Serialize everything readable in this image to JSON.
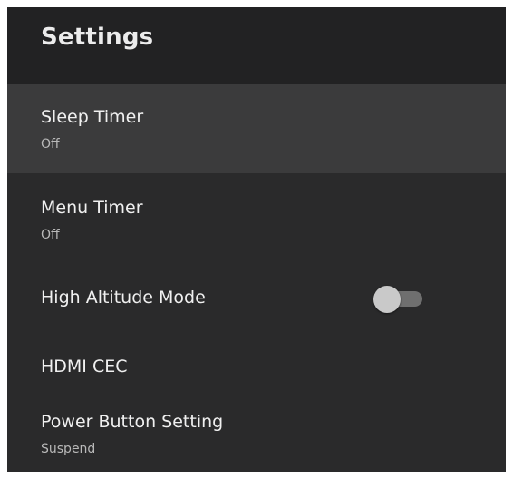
{
  "header": {
    "title": "Settings"
  },
  "items": [
    {
      "label": "Sleep Timer",
      "value": "Off",
      "focused": true
    },
    {
      "label": "Menu Timer",
      "value": "Off"
    },
    {
      "label": "High Altitude Mode",
      "toggle": false
    },
    {
      "label": "HDMI CEC"
    },
    {
      "label": "Power Button Setting",
      "value": "Suspend"
    }
  ],
  "colors": {
    "panel_background": "#2a2a2b",
    "header_background": "#222223",
    "focused_background": "#3b3b3c",
    "toggle_off_track": "#6f6f6f",
    "toggle_off_thumb": "#c9c9c9"
  }
}
